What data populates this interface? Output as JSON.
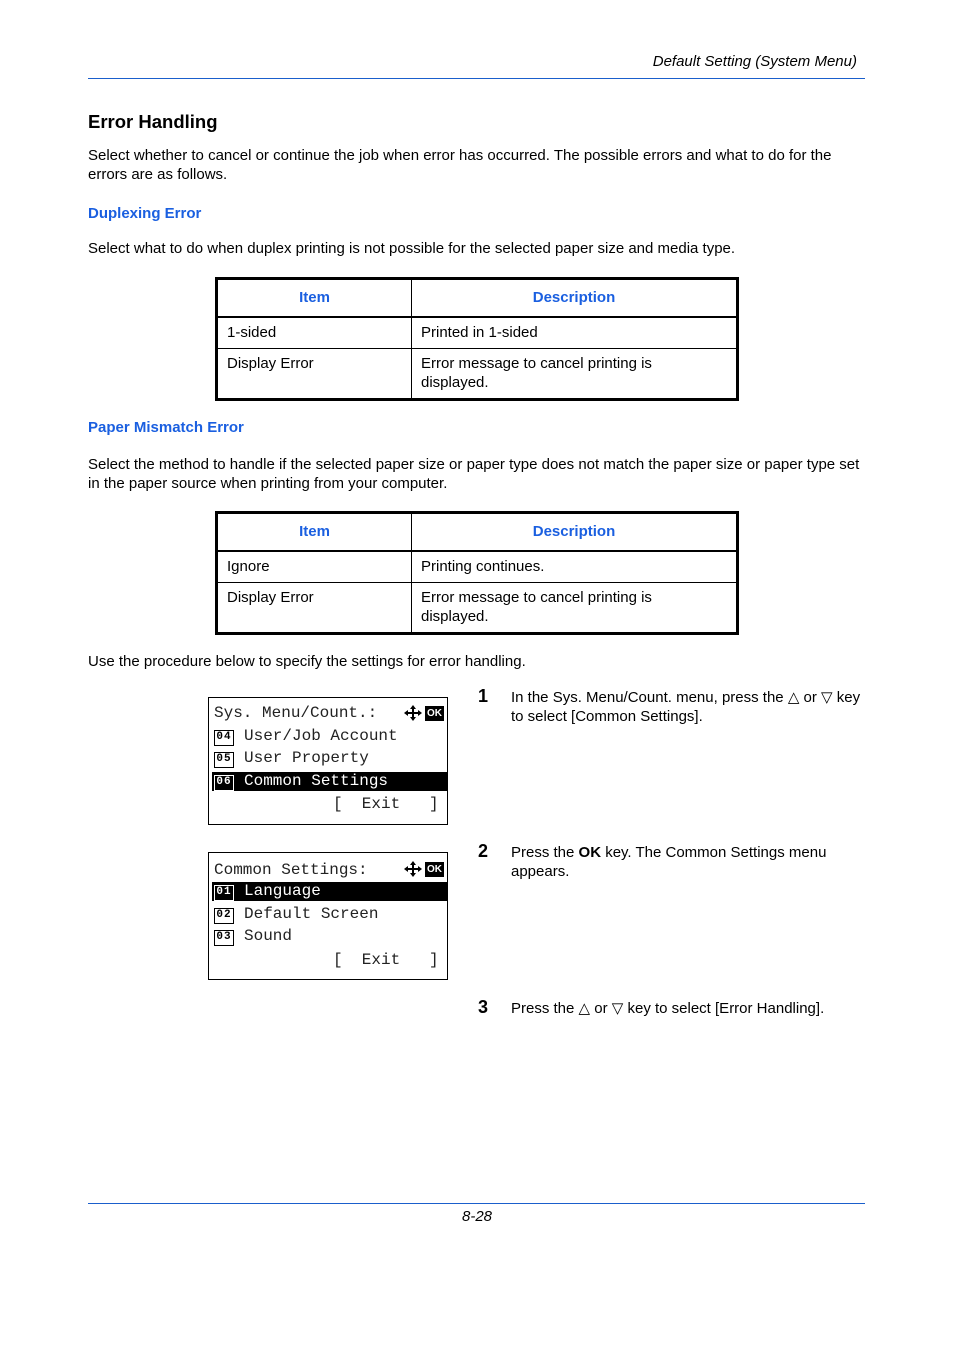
{
  "header": {
    "section_title": "Default Setting (System Menu)"
  },
  "main": {
    "title": "Error Handling",
    "intro": "Select whether to cancel or continue the job when error has occurred. The possible errors and what to do for the errors are as follows.",
    "duplexing": {
      "heading": "Duplexing Error",
      "text": "Select what to do when duplex printing is not possible for the selected paper size and media type.",
      "table": {
        "headers": [
          "Item",
          "Description"
        ],
        "rows": [
          [
            "1-sided",
            "Printed in 1-sided"
          ],
          [
            "Display Error",
            "Error message to cancel printing is displayed."
          ]
        ]
      }
    },
    "mismatch": {
      "heading": "Paper Mismatch Error",
      "text": "Select the method to handle if the selected paper size or paper type does not match the paper size or paper type set in the paper source when printing from your computer.",
      "table": {
        "headers": [
          "Item",
          "Description"
        ],
        "rows": [
          [
            "Ignore",
            "Printing continues."
          ],
          [
            "Display Error",
            "Error message to cancel printing is displayed."
          ]
        ]
      }
    },
    "procedure_intro": "Use the procedure below to specify the settings for error handling."
  },
  "screens": [
    {
      "title": "Sys. Menu/Count.:",
      "ok_label": "OK",
      "items": [
        {
          "num": "04",
          "label": "User/Job Account",
          "selected": false
        },
        {
          "num": "05",
          "label": "User Property",
          "selected": false
        },
        {
          "num": "06",
          "label": "Common Settings",
          "selected": true
        }
      ],
      "softkey": "[  Exit   ]"
    },
    {
      "title": "Common Settings:",
      "ok_label": "OK",
      "items": [
        {
          "num": "01",
          "label": "Language",
          "selected": true
        },
        {
          "num": "02",
          "label": "Default Screen",
          "selected": false
        },
        {
          "num": "03",
          "label": "Sound",
          "selected": false
        }
      ],
      "softkey": "[  Exit   ]"
    }
  ],
  "steps": [
    {
      "number": "1",
      "pre": "In the Sys. Menu/Count. menu, press the ",
      "up": "△",
      "mid": " or ",
      "down": "▽",
      "post": " key to select [Common Settings]."
    },
    {
      "number": "2",
      "pre": "Press the ",
      "bold": "OK",
      "post": " key. The Common Settings menu appears."
    },
    {
      "number": "3",
      "pre": "Press the ",
      "up": "△",
      "mid": " or ",
      "down": "▽",
      "post": " key to select [Error Handling]."
    }
  ],
  "footer": {
    "page_number": "8-28"
  }
}
